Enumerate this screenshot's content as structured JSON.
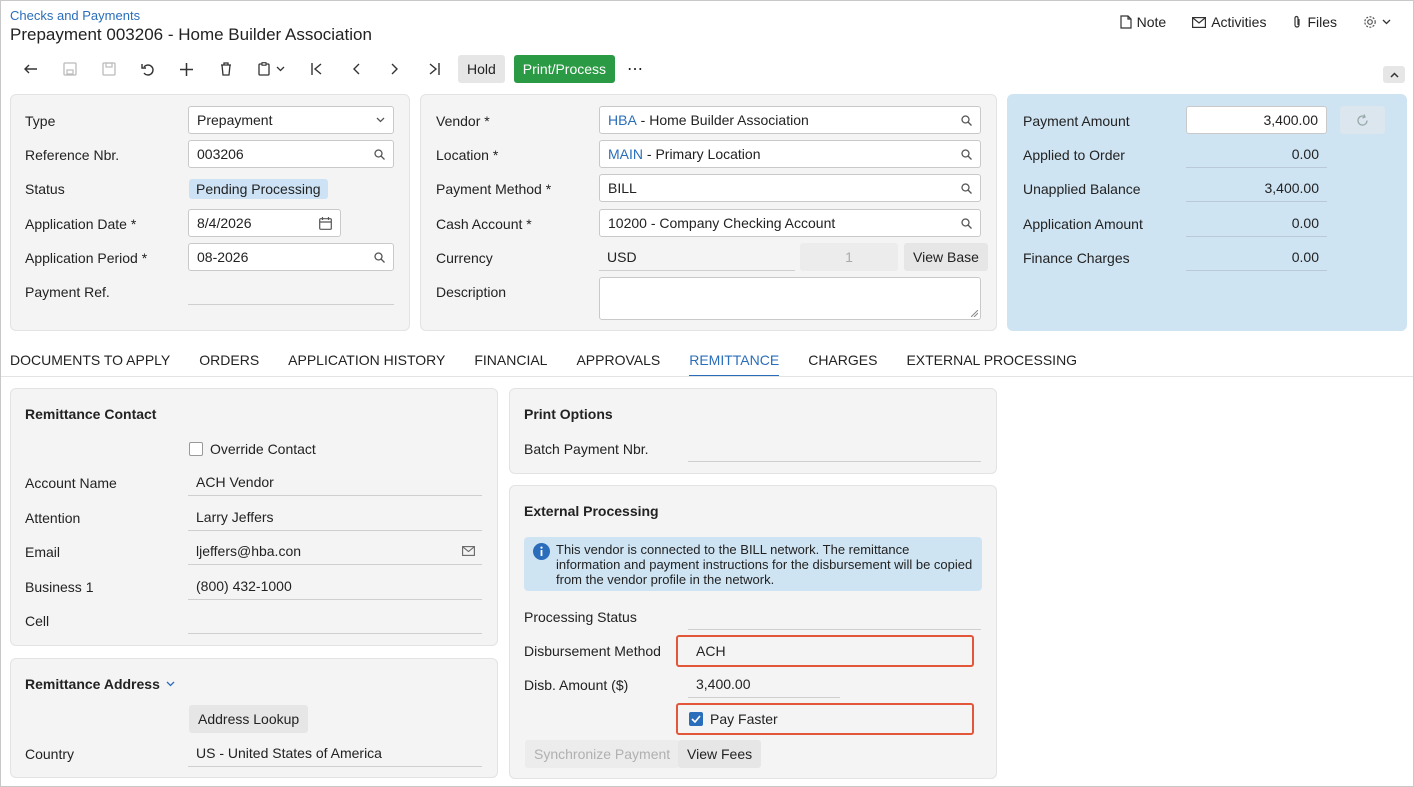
{
  "header": {
    "breadcrumb": "Checks and Payments",
    "title": "Prepayment 003206 - Home Builder Association",
    "actions": {
      "note": "Note",
      "activities": "Activities",
      "files": "Files"
    }
  },
  "toolbar": {
    "hold": "Hold",
    "print_process": "Print/Process",
    "more": "⋯"
  },
  "summary_left": {
    "type_label": "Type",
    "type_value": "Prepayment",
    "ref_label": "Reference Nbr.",
    "ref_value": "003206",
    "status_label": "Status",
    "status_value": "Pending Processing",
    "app_date_label": "Application Date *",
    "app_date_value": "8/4/2026",
    "app_period_label": "Application Period *",
    "app_period_value": "08-2026",
    "payment_ref_label": "Payment Ref."
  },
  "summary_mid": {
    "vendor_label": "Vendor *",
    "vendor_code": "HBA",
    "vendor_name": " - Home Builder Association",
    "location_label": "Location *",
    "location_code": "MAIN",
    "location_name": " - Primary Location",
    "payment_method_label": "Payment Method *",
    "payment_method_value": "BILL",
    "cash_account_label": "Cash Account *",
    "cash_account_value": "10200 - Company Checking Account",
    "currency_label": "Currency",
    "currency_value": "USD",
    "rate_value": "1",
    "view_base": "View Base",
    "description_label": "Description"
  },
  "summary_right": {
    "payment_amount_label": "Payment Amount",
    "payment_amount_value": "3,400.00",
    "applied_label": "Applied to Order",
    "applied_value": "0.00",
    "unapplied_label": "Unapplied Balance",
    "unapplied_value": "3,400.00",
    "application_label": "Application Amount",
    "application_value": "0.00",
    "finance_label": "Finance Charges",
    "finance_value": "0.00"
  },
  "tabs": [
    "DOCUMENTS TO APPLY",
    "ORDERS",
    "APPLICATION HISTORY",
    "FINANCIAL",
    "APPROVALS",
    "REMITTANCE",
    "CHARGES",
    "EXTERNAL PROCESSING"
  ],
  "remit_contact": {
    "title": "Remittance Contact",
    "override": "Override Contact",
    "account_label": "Account Name",
    "account_value": "ACH Vendor",
    "attention_label": "Attention",
    "attention_value": "Larry Jeffers",
    "email_label": "Email",
    "email_value": "ljeffers@hba.con",
    "business_label": "Business 1",
    "business_value": "(800) 432-1000",
    "cell_label": "Cell"
  },
  "remit_address": {
    "title": "Remittance Address",
    "lookup": "Address Lookup",
    "country_label": "Country",
    "country_value": "US - United States of America"
  },
  "print_options": {
    "title": "Print Options",
    "batch_label": "Batch Payment Nbr."
  },
  "external": {
    "title": "External Processing",
    "info": "This vendor is connected to the BILL network. The remittance information and payment instructions for the disbursement will be copied from the vendor profile in the network.",
    "status_label": "Processing Status",
    "disb_method_label": "Disbursement Method",
    "disb_method_value": "ACH",
    "disb_amount_label": "Disb. Amount ($)",
    "disb_amount_value": "3,400.00",
    "pay_faster": "Pay Faster",
    "sync": "Synchronize Payment",
    "view_fees": "View Fees"
  },
  "colors": {
    "accent": "#2a6ebb",
    "primary_button": "#2b9a45",
    "highlight": "#e2563a"
  }
}
